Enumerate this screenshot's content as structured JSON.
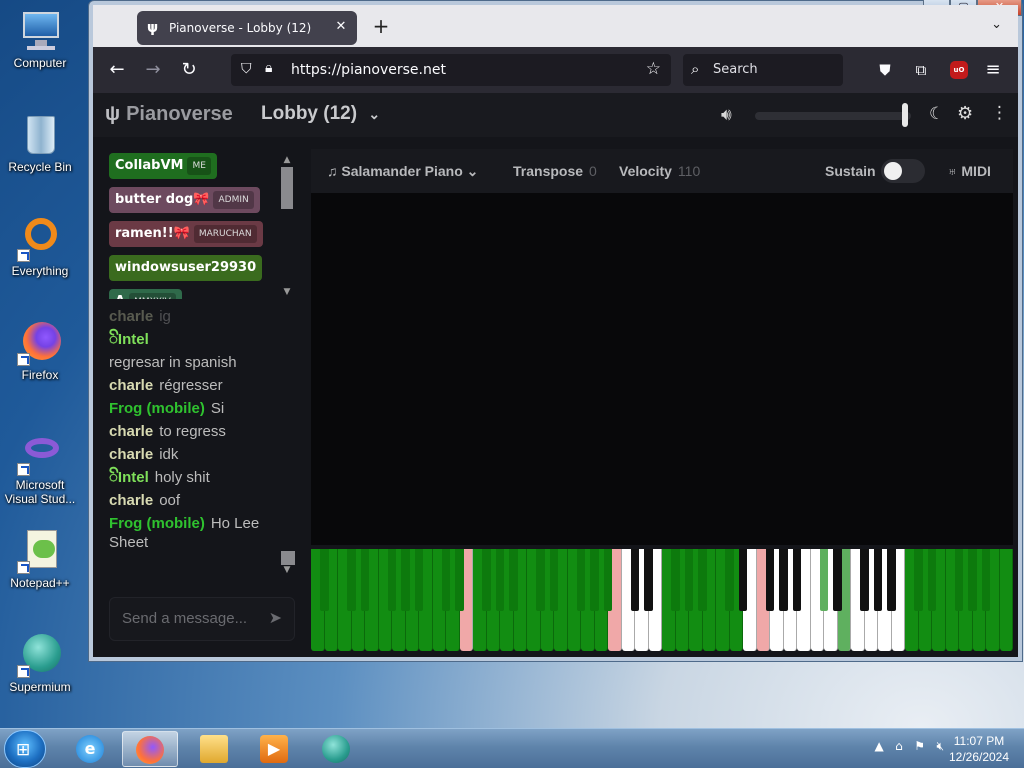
{
  "desktop": {
    "icons": [
      {
        "label": "Computer"
      },
      {
        "label": "Recycle Bin"
      },
      {
        "label": "Everything"
      },
      {
        "label": "Firefox"
      },
      {
        "label": "Microsoft Visual Stud..."
      },
      {
        "label": "Notepad++"
      },
      {
        "label": "Supermium"
      }
    ]
  },
  "browser": {
    "tab_title": "Pianoverse - Lobby (12)",
    "url": "https://pianoverse.net",
    "search_placeholder": "Search",
    "ublock_label": "uO"
  },
  "app": {
    "logo": "Pianoverse",
    "room": "Lobby (12)",
    "users": [
      {
        "name": "CollabVM",
        "badge": "ME",
        "color": "#1f6e1f"
      },
      {
        "name": "butter dog🎀",
        "badge": "ADMIN",
        "color": "#6d4a5f"
      },
      {
        "name": "ramen!!🎀",
        "badge": "MARUCHAN",
        "color": "#6b3a45"
      },
      {
        "name": "windowsuser29930",
        "badge": "",
        "color": "#3a6b1e"
      },
      {
        "name": "A",
        "badge": "MMXXIV",
        "color": "#2f6a4a"
      }
    ],
    "chat": [
      {
        "nick": "charle",
        "text": "ig",
        "color": "#d8dab2"
      },
      {
        "nick": "ꦼIntel",
        "text": "",
        "color": "#7fe05a"
      },
      {
        "nick": "",
        "text": "regresar in spanish",
        "color": "#bcbcbc"
      },
      {
        "nick": "charle",
        "text": "régresser",
        "color": "#d8dab2"
      },
      {
        "nick": "Frog (mobile)",
        "text": "Si",
        "color": "#2fc22f"
      },
      {
        "nick": "charle",
        "text": "to regress",
        "color": "#d8dab2"
      },
      {
        "nick": "charle",
        "text": "idk",
        "color": "#d8dab2"
      },
      {
        "nick": "ꦼIntel",
        "text": "holy shit",
        "color": "#7fe05a"
      },
      {
        "nick": "charle",
        "text": "oof",
        "color": "#d8dab2"
      },
      {
        "nick": "Frog (mobile)",
        "text": "Ho Lee Sheet",
        "color": "#2fc22f"
      }
    ],
    "message_placeholder": "Send a message...",
    "volume_fraction": 0.98,
    "toolbar": {
      "instrument": "Salamander Piano",
      "transpose_label": "Transpose",
      "transpose_value": "0",
      "velocity_label": "Velocity",
      "velocity_value": "110",
      "sustain_label": "Sustain",
      "midi_label": "MIDI"
    },
    "key_colors": {
      "green": "#128d12",
      "pink": "#f0a8a8",
      "white": "#ffffff",
      "light_green": "#5fb05f"
    }
  },
  "taskbar": {
    "time": "11:07 PM",
    "date": "12/26/2024"
  }
}
